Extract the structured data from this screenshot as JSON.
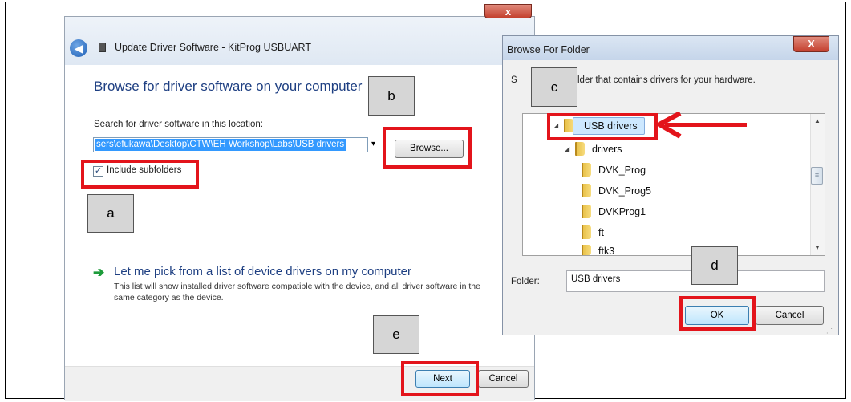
{
  "update_dialog": {
    "title": "Update Driver Software - KitProg USBUART",
    "close_icon": "close-icon",
    "back_icon": "back-arrow-icon",
    "heading": "Browse for driver software on your computer",
    "search_label": "Search for driver software in this location:",
    "path_value": "sers\\efukawa\\Desktop\\CTW\\EH Workshop\\Labs\\USB drivers",
    "dropdown_glyph": "▾",
    "browse_label": "Browse...",
    "include_subfolders_label": "Include subfolders",
    "include_subfolders_checked": true,
    "checkmark": "✓",
    "pick_arrow": "➔",
    "pick_link": "Let me pick from a list of device drivers on my computer",
    "pick_desc": "This list will show installed driver software compatible with the device, and all driver software in the same category as the device.",
    "next_label": "Next",
    "cancel_label": "Cancel"
  },
  "browse_dialog": {
    "title": "Browse For Folder",
    "close_glyph": "X",
    "instruction_prefix": "S",
    "instruction": "lder that contains drivers for your hardware.",
    "tree": {
      "root": "USB drivers",
      "child": "drivers",
      "items": [
        "DVK_Prog",
        "DVK_Prog5",
        "DVKProg1",
        "ft",
        "ftk3"
      ],
      "expanded_glyph": "◢"
    },
    "scroll_up": "▲",
    "scroll_down": "▼",
    "scroll_thumb_glyph": "≡",
    "folder_label": "Folder:",
    "folder_value": "USB drivers",
    "ok_label": "OK",
    "cancel_label": "Cancel",
    "resize_grip": "⋰"
  },
  "annotations": {
    "a": "a",
    "b": "b",
    "c": "c",
    "d": "d",
    "e": "e",
    "highlight_color": "#e3141b"
  }
}
